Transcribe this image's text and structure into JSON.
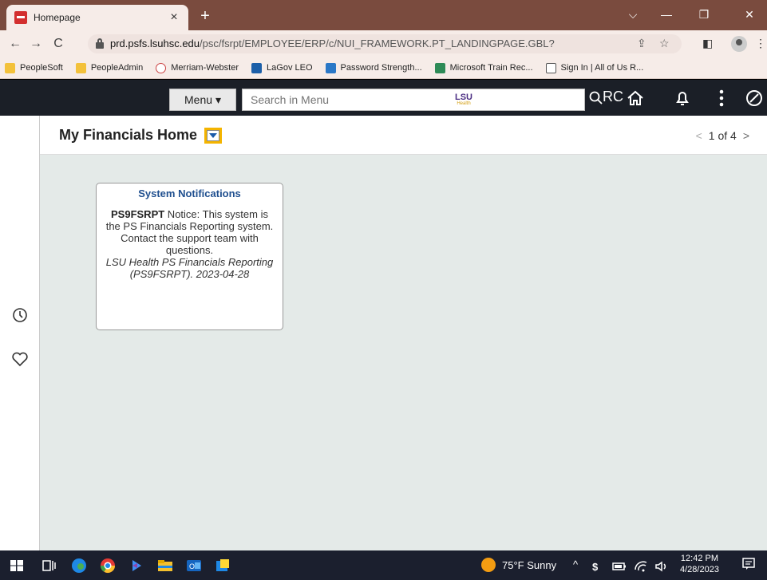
{
  "browser": {
    "tab": {
      "title": "Homepage",
      "close": "×"
    },
    "newtab": "+",
    "window_controls": {
      "dropdown": "⌵",
      "minimize": "—",
      "restore": "❐",
      "close": "✕"
    },
    "url_host": "prd.psfs.lsuhsc.edu",
    "url_path": "/psc/fsrpt/EMPLOYEE/ERP/c/NUI_FRAMEWORK.PT_LANDINGPAGE.GBL?",
    "nav": {
      "back": "←",
      "forward": "→",
      "reload": "C"
    },
    "omni_icons": {
      "share": "⇪",
      "star": "☆"
    },
    "toolbar": {
      "sidepanel": "◧",
      "menu": "⋮"
    },
    "bookmarks": [
      {
        "label": "PeopleSoft",
        "icon": "folder-icon"
      },
      {
        "label": "PeopleAdmin",
        "icon": "folder-icon"
      },
      {
        "label": "Merriam-Webster",
        "icon": "mw-icon"
      },
      {
        "label": "LaGov LEO",
        "icon": "sap-icon"
      },
      {
        "label": "Password Strength...",
        "icon": "pw-icon"
      },
      {
        "label": "Microsoft Train Rec...",
        "icon": "ms-icon"
      },
      {
        "label": "Sign In | All of Us R...",
        "icon": "allofus-icon"
      }
    ]
  },
  "header": {
    "menu_label": "Menu",
    "menu_caret": "▾",
    "search_placeholder": "Search in Menu",
    "logo_top": "LSU",
    "logo_bottom": "Health",
    "right_label": "RC"
  },
  "page": {
    "title": "My Financials Home",
    "pager_text": "1 of 4",
    "prev": "<",
    "next": ">"
  },
  "tile": {
    "title": "System Notifications",
    "code": "PS9FSRPT",
    "line1": " Notice: This system is the PS Financials Reporting system. Contact the support team with questions.",
    "italic": "LSU Health PS Financials Reporting (PS9FSRPT). 2023-04-28"
  },
  "taskbar": {
    "weather": "75°F  Sunny",
    "tray_caret": "^",
    "time": "12:42 PM",
    "date": "4/28/2023"
  },
  "colors": {
    "tabstrip": "#7a4b3e",
    "header": "#1b1f27",
    "canvas": "#e4eae8",
    "accent": "#f4b400",
    "tile_title": "#1f4f8f"
  }
}
